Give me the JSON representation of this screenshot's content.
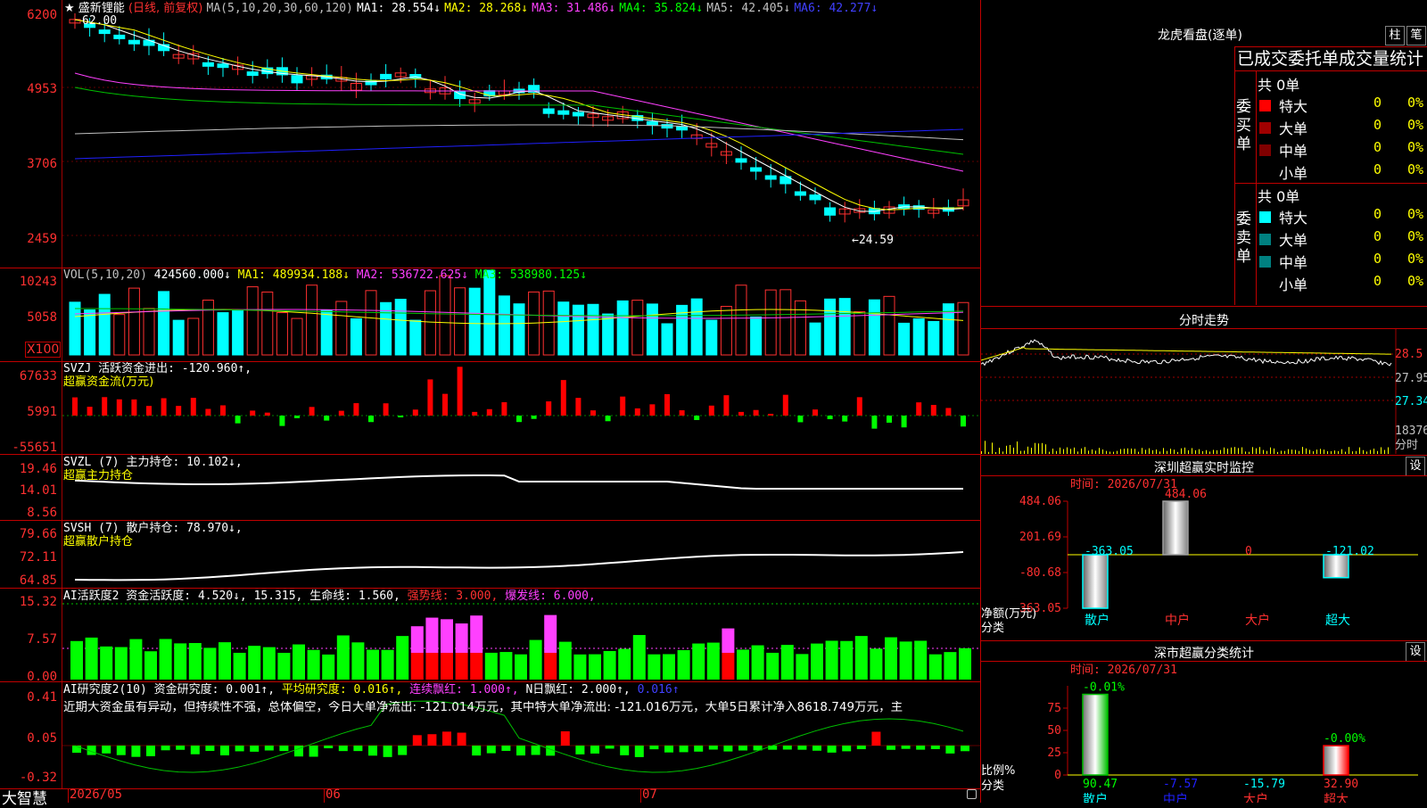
{
  "colors": {
    "up": "#ff3030",
    "down": "#00ffff",
    "bg": "#000000",
    "grid": "#a00000",
    "ma5": "#ffffff",
    "ma10": "#ffff00",
    "ma20": "#ff40ff",
    "ma30": "#00c000",
    "ma60": "#c0c0c0",
    "ma120": "#2020ff"
  },
  "main": {
    "stock_name": "盛新锂能",
    "period": "(日线, 前复权)",
    "ma_label": "MA(5,10,20,30,60,120)",
    "ma1": "MA1: 28.554↓",
    "ma2": "MA2: 28.268↓",
    "ma3": "MA3: 31.486↓",
    "ma4": "MA4: 35.824↓",
    "ma5": "MA5: 42.405↓",
    "ma6": "MA6: 42.277↓",
    "star": "★",
    "high_mark": "62.00",
    "low_mark": "←24.59",
    "ylabels": [
      "6200",
      "4953",
      "3706",
      "2459"
    ]
  },
  "vol": {
    "title": "VOL(5,10,20)",
    "value": "424560.000↓",
    "ma1": "MA1: 489934.188↓",
    "ma2": "MA2: 536722.625↓",
    "ma3": "MA3: 538980.125↓",
    "ylabels": [
      "10243",
      "5058"
    ],
    "unit": "X100"
  },
  "svzj": {
    "title": "SVZJ  活跃资金进出: -120.960↑,",
    "sub": "超赢资金流(万元)",
    "ylabels": [
      "67633",
      "5991",
      "-55651"
    ]
  },
  "svzl": {
    "title": "SVZL (7) 主力持仓: 10.102↓,",
    "sub": "超赢主力持仓",
    "ylabels": [
      "19.46",
      "14.01",
      "8.56"
    ]
  },
  "svsh": {
    "title": "SVSH (7) 散户持仓: 78.970↓,",
    "sub": "超赢散户持仓",
    "ylabels": [
      "79.66",
      "72.11",
      "64.85"
    ]
  },
  "ai2": {
    "p1": "AI活跃度2 资金活跃度: 4.520↓,",
    "p2": "15.315,",
    "p3": "生命线: 1.560,",
    "p4": "强势线: 3.000,",
    "p5": "爆发线: 6.000,",
    "ylabels": [
      "15.32",
      "7.57",
      "0.00"
    ]
  },
  "ai3": {
    "p1": "AI研究度2(10) 资金研究度: 0.001↑,",
    "p2": "平均研究度: 0.016↑,",
    "p3": "连续飘红: 1.000↑,",
    "p4": "N日飘红: 2.000↑,",
    "p5": "0.016↑",
    "comment": "近期大资金虽有异动，但持续性不强，总体偏空，今日大单净流出: -121.014万元，其中特大单净流出: -121.016万元，大单5日累计净入8618.749万元，主",
    "ylabels": [
      "0.41",
      "0.05",
      "-0.32"
    ]
  },
  "xaxis": {
    "brand": "大智慧",
    "labels": [
      "2026/05",
      "06",
      "07"
    ]
  },
  "right": {
    "top_title": "龙虎看盘(逐单)",
    "btn1": "柱",
    "btn2": "笔",
    "section_title": "已成交委托单成交量统计",
    "buy_label": "委买单",
    "sell_label": "委卖单",
    "buy_total": "共 0单",
    "sell_total": "共 0单",
    "buy_rows": [
      {
        "name": "特大",
        "count": "0",
        "pct": "0%",
        "color": "#ff0000"
      },
      {
        "name": "大单",
        "count": "0",
        "pct": "0%",
        "color": "#a00000"
      },
      {
        "name": "中单",
        "count": "0",
        "pct": "0%",
        "color": "#800000"
      },
      {
        "name": "小单",
        "count": "0",
        "pct": "0%",
        "color": "#000000"
      }
    ],
    "sell_rows": [
      {
        "name": "特大",
        "count": "0",
        "pct": "0%",
        "color": "#00ffff"
      },
      {
        "name": "大单",
        "count": "0",
        "pct": "0%",
        "color": "#008080"
      },
      {
        "name": "中单",
        "count": "0",
        "pct": "0%",
        "color": "#008080"
      },
      {
        "name": "小单",
        "count": "0",
        "pct": "0%",
        "color": "#000000"
      }
    ],
    "intraday_title": "分时走势",
    "intraday_ylabels": [
      "28.5",
      "27.95",
      "27.34",
      "18376",
      "分时"
    ],
    "monitor_title": "深圳超赢实时监控",
    "monitor_btn": "设",
    "monitor_time": "时间: 2026/07/31",
    "monitor_ylabels": [
      "484.06",
      "201.69",
      "-80.68",
      "-363.05"
    ],
    "monitor_axis": "净额(万元)",
    "monitor_axis2": "分类",
    "classify_title": "深市超赢分类统计",
    "classify_btn": "设",
    "classify_time": "时间: 2026/07/31",
    "classify_ylabels": [
      "75",
      "50",
      "25",
      "0"
    ],
    "classify_axis": "比例%",
    "classify_axis2": "分类"
  },
  "chart_data": [
    {
      "type": "bar",
      "title": "深圳超赢实时监控",
      "ylabel": "净额(万元)",
      "categories": [
        "散户",
        "中户",
        "大户",
        "超大"
      ],
      "values": [
        -363.05,
        484.06,
        0,
        -121.02
      ],
      "value_labels": [
        "-363.05",
        "484.06",
        "0",
        "-121.02"
      ],
      "ylim": [
        -363.05,
        484.06
      ]
    },
    {
      "type": "bar",
      "title": "深市超赢分类统计",
      "ylabel": "比例%",
      "categories": [
        "散户",
        "中户",
        "大户",
        "超大"
      ],
      "values": [
        90.47,
        -7.57,
        -15.79,
        32.9
      ],
      "value_labels": [
        "90.47",
        "-7.57",
        "-15.79",
        "32.90"
      ],
      "top_labels": [
        "-0.01%",
        "",
        "",
        "-0.00%"
      ],
      "ylim": [
        0,
        100
      ]
    },
    {
      "type": "line",
      "title": "盛新锂能 (日线, 前复权)",
      "series": [
        {
          "name": "MA1",
          "values": [
            28.554
          ]
        },
        {
          "name": "MA2",
          "values": [
            28.268
          ]
        },
        {
          "name": "MA3",
          "values": [
            31.486
          ]
        },
        {
          "name": "MA4",
          "values": [
            35.824
          ]
        },
        {
          "name": "MA5",
          "values": [
            42.405
          ]
        },
        {
          "name": "MA6",
          "values": [
            42.277
          ]
        }
      ]
    }
  ]
}
